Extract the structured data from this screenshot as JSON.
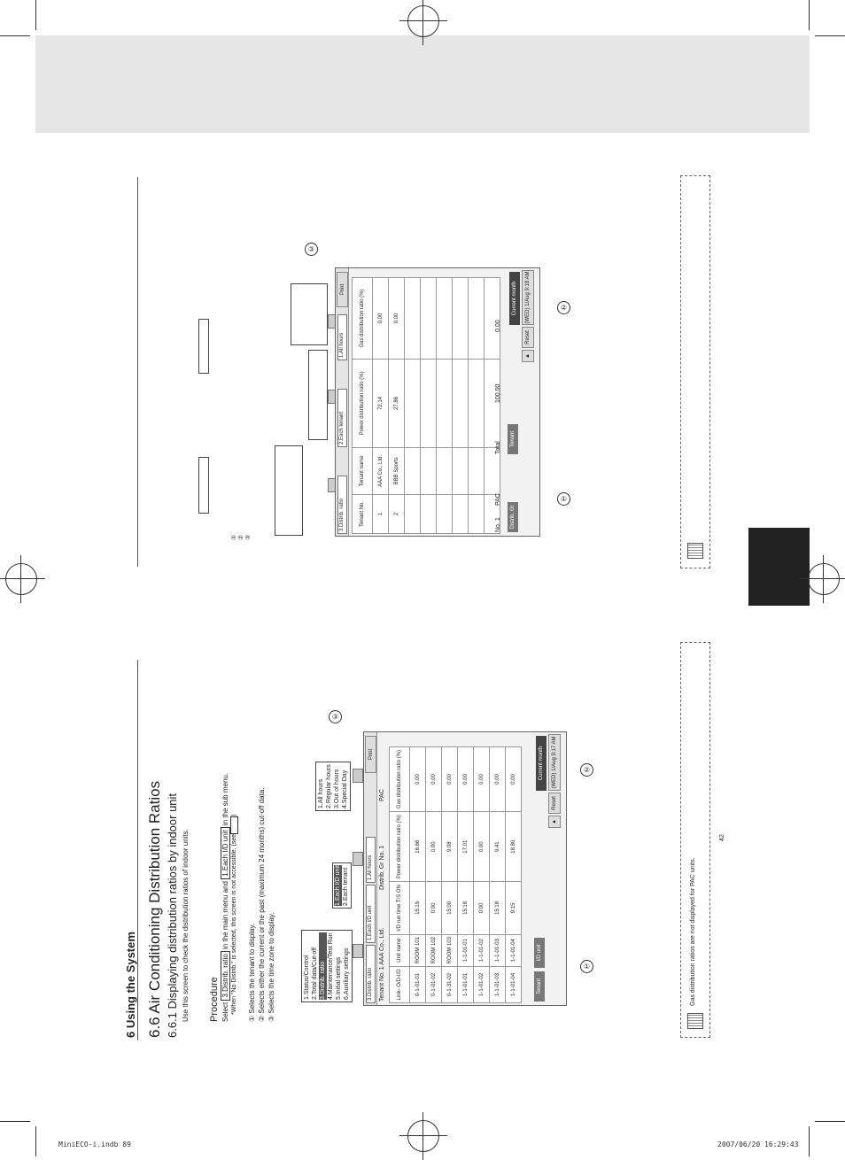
{
  "header": {
    "section": "6 Using the System",
    "title": "6.6 Air Conditioning Distribution Ratios",
    "subtitle": "6.6.1 Displaying distribution ratios by indoor unit",
    "intro": "Use this screen to check the distribution ratios of indoor units."
  },
  "procedure": {
    "heading": "Procedure",
    "line1_a": "Select ",
    "line1_b": "3.Distrib. ratio",
    "line1_c": " in the main menu and ",
    "line1_d": "1.Each I/D unit",
    "line1_e": " in the sub menu.",
    "line2": "*When \"No Distrib.\" is selected, this screen is not accessible. (see",
    "line2_end": ")",
    "steps": [
      "① Selects the tenant to display.",
      "② Selects either the current or the past (maximum 24 months) cut-off data.",
      "③ Selects the time zone to display."
    ]
  },
  "main_menu": [
    "1.Status/Control",
    "2.Total data/Cut-off",
    "3.Distrib. ratio",
    "4.Maintenance/Test Run",
    "5.Initial settings",
    "6.Auxiliary settings"
  ],
  "sub_menu": [
    "1.Each I/D unit",
    "2.Each tenant"
  ],
  "time_menu": [
    "1.All hours",
    "2.Regular hours",
    "3.Out of hours",
    "4.Special Day"
  ],
  "screen1": {
    "dd1": "3.Distrib. ratio",
    "dd2": "1.Each I/D unit",
    "dd3": "1.All hours",
    "print": "Print",
    "tenant_line": "Tenant No.  1  AAA Co., Ltd.",
    "group_line": "Distrib. Gr No.  1",
    "pac": "PAC",
    "headers": [
      "Link-\nO/D-I/D",
      "Unit name",
      "I/D run time\nT/S ON",
      "Power distribution\nratio (%)",
      "Gas distribution\nratio (%)"
    ],
    "rows": [
      [
        "0-1-01-01",
        "ROOM 101",
        "15:15",
        "16.66",
        "0.00"
      ],
      [
        "0-1-01-02",
        "ROOM 102",
        "0:00",
        "0.00",
        "0.00"
      ],
      [
        "0-1-31-02",
        "ROOM 103",
        "15:00",
        "9.08",
        "0.00"
      ],
      [
        "1-1-01-01",
        "1-1-01-01",
        "15:18",
        "17.01",
        "0.00"
      ],
      [
        "1-1-01-02",
        "1-1-01-02",
        "0:00",
        "0.00",
        "0.00"
      ],
      [
        "1-1-01-03",
        "1-1-01-03",
        "15:18",
        "9.41",
        "0.00"
      ],
      [
        "1-1-01-04",
        "1-1-01-04",
        "9:15",
        "18.80",
        "0.00"
      ]
    ],
    "btn_tenant": "Tenant",
    "btn_iou": "I/D unit",
    "btn_reset": "Reset",
    "month": "Current month",
    "clock": "(WED) 1/Aug 9:17 AM"
  },
  "screen2": {
    "dd1": "3.Distrib. ratio",
    "dd2": "2.Each tenant",
    "dd3": "1.All hours",
    "print": "Print",
    "headers": [
      "Tenant\nNo.",
      "Tenant name",
      "Power distribution\nratio (%)",
      "Gas distribution\nratio (%)"
    ],
    "rows": [
      [
        "1",
        "AAA Co., Ltd.",
        "72.14",
        "0.00"
      ],
      [
        "2",
        "BBB Sports",
        "27.86",
        "0.00"
      ]
    ],
    "footer_no": "No. 1",
    "footer_pac": "PAC",
    "total_label": "Total",
    "total_power": "100.00",
    "total_gas": "0.00",
    "btn_distrib": "Distrib. Gr",
    "btn_tenant": "Tenant",
    "btn_reset": "Reset",
    "month": "Current month",
    "clock": "(WED) 1/Aug 9:18 AM"
  },
  "callouts": [
    "①",
    "②",
    "③"
  ],
  "note": "Gas distribution ratios are not displayed for PAC units.",
  "page_number": "42",
  "footer_left": "MiniECO-i.indb   89",
  "footer_right": "2007/06/20   16:29:43"
}
